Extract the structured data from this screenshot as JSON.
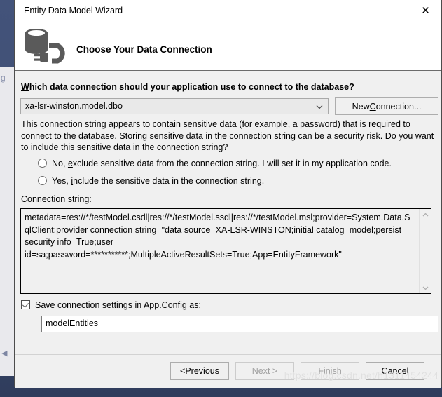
{
  "window": {
    "title": "Entity Data Model Wizard",
    "close_label": "✕",
    "header_title": "Choose Your Data Connection",
    "header_icon": "database-plug-icon"
  },
  "form": {
    "question_label_prefix": "W",
    "question_label_rest": "hich data connection should your application use to connect to the database?",
    "connection_dropdown": {
      "value": "xa-lsr-winston.model.dbo",
      "arrow_icon": "chevron-down-icon"
    },
    "new_connection_button": {
      "prefix": "New ",
      "accel": "C",
      "suffix": "onnection..."
    },
    "warning_text": "This connection string appears to contain sensitive data (for example, a password) that is required to connect to the database. Storing sensitive data in the connection string can be a security risk. Do you want to include this sensitive data in the connection string?",
    "radios": [
      {
        "id": "exclude-sensitive-data",
        "pre": "No, ",
        "accel": "e",
        "post": "xclude sensitive data from the connection string. I will set it in my application code.",
        "selected": false
      },
      {
        "id": "include-sensitive-data",
        "pre": "Yes, ",
        "accel": "i",
        "post": "nclude the sensitive data in the connection string.",
        "selected": false
      }
    ],
    "connection_string_label": "Connection string:",
    "connection_string_value": "metadata=res://*/testModel.csdl|res://*/testModel.ssdl|res://*/testModel.msl;provider=System.Data.SqlClient;provider connection string=\"data source=XA-LSR-WINSTON;initial catalog=model;persist security info=True;user id=sa;password=***********;MultipleActiveResultSets=True;App=EntityFramework\"",
    "scrollbar": {
      "up_icon": "chevron-up-icon",
      "down_icon": "chevron-down-icon"
    },
    "save_checkbox": {
      "checked": true,
      "accel": "S",
      "label_rest": "ave connection settings in App.Config as:"
    },
    "entities_name_value": "modelEntities"
  },
  "footer": {
    "previous": {
      "pre": "< ",
      "accel": "P",
      "post": "revious",
      "enabled": true
    },
    "next": {
      "pre": "",
      "accel": "N",
      "post": "ext >",
      "enabled": false
    },
    "finish": {
      "pre": "",
      "accel": "F",
      "post": "inish",
      "enabled": false
    },
    "cancel": {
      "pre": "",
      "accel": "C",
      "post": "ancel",
      "enabled": true
    }
  },
  "watermark": "https://blog.csdn.net/h1311454244",
  "colors": {
    "dialog_bg": "#f0f0f0",
    "header_bg": "#ffffff",
    "icon_gray": "#5a5a5a",
    "desktop_bg": "#3d4d72",
    "disabled_text": "#a0a0a0"
  }
}
